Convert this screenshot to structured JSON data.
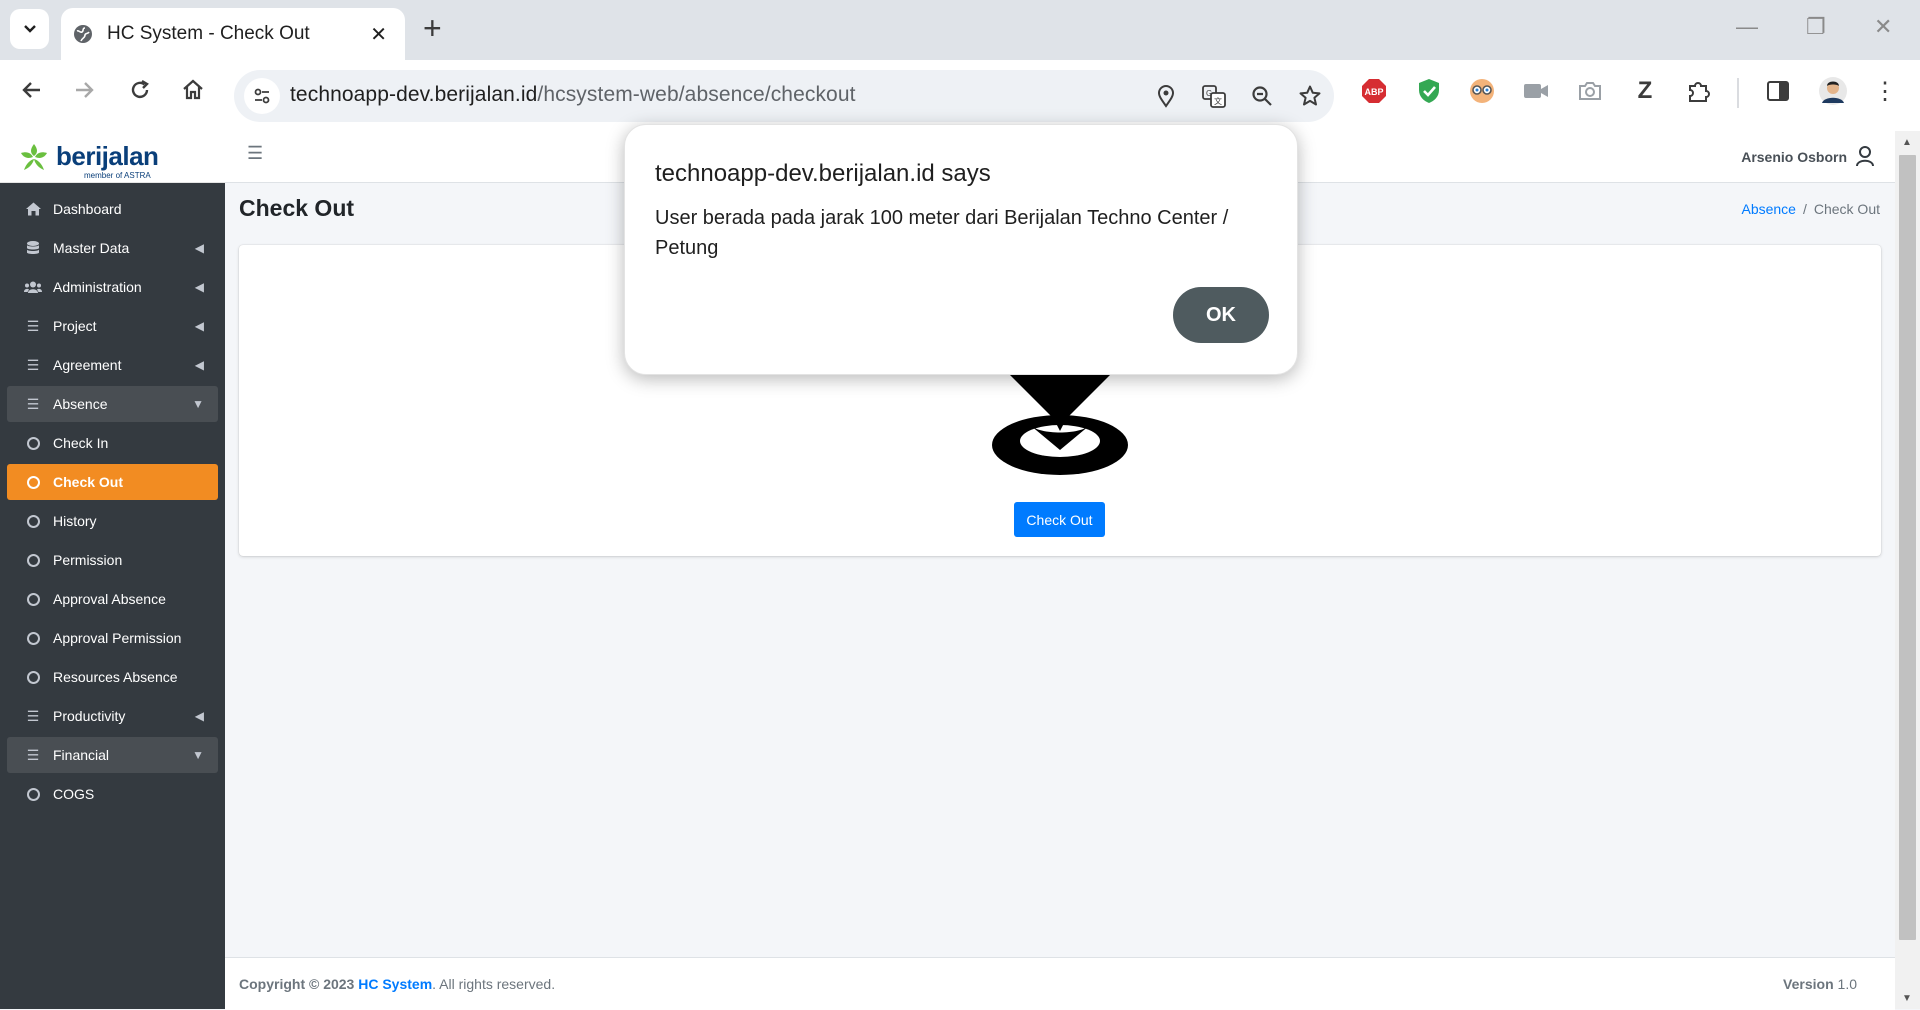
{
  "browser": {
    "tab_title": "HC System - Check Out",
    "url_host": "technoapp-dev.berijalan.id",
    "url_path": "/hcsystem-web/absence/checkout",
    "extensions": [
      "ABP",
      "shield",
      "glasses",
      "camera-off",
      "camera",
      "Z",
      "puzzle"
    ]
  },
  "app": {
    "brand_name": "berijalan",
    "brand_sub": "member of ASTRA",
    "user_name": "Arsenio Osborn",
    "page_title": "Check Out",
    "breadcrumb": {
      "parent": "Absence",
      "sep": "/",
      "current": "Check Out"
    },
    "checkout_button": "Check Out",
    "sidebar": [
      {
        "label": "Dashboard",
        "icon": "home-icon"
      },
      {
        "label": "Master Data",
        "icon": "database-icon"
      },
      {
        "label": "Administration",
        "icon": "users-icon"
      },
      {
        "label": "Project",
        "icon": "tasks-icon"
      },
      {
        "label": "Agreement",
        "icon": "tasks-icon"
      },
      {
        "label": "Absence",
        "icon": "tasks-icon"
      },
      {
        "label": "Check In",
        "icon": "circle-icon"
      },
      {
        "label": "Check Out",
        "icon": "circle-icon"
      },
      {
        "label": "History",
        "icon": "circle-icon"
      },
      {
        "label": "Permission",
        "icon": "circle-icon"
      },
      {
        "label": "Approval Absence",
        "icon": "circle-icon"
      },
      {
        "label": "Approval Permission",
        "icon": "circle-icon"
      },
      {
        "label": "Resources Absence",
        "icon": "circle-icon"
      },
      {
        "label": "Productivity",
        "icon": "tasks-icon"
      },
      {
        "label": "Financial",
        "icon": "tasks-icon"
      },
      {
        "label": "COGS",
        "icon": "circle-icon"
      }
    ],
    "footer": {
      "copyright": "Copyright © 2023",
      "brand": "HC System",
      "rights": ". All rights reserved.",
      "version_label": "Version",
      "version": "1.0"
    }
  },
  "dialog": {
    "title": "technoapp-dev.berijalan.id says",
    "message": "User berada pada jarak 100 meter dari Berijalan Techno Center / Petung",
    "ok": "OK"
  },
  "colors": {
    "sidebar_bg": "#343a40",
    "active_item": "#f28c22",
    "primary": "#007bff",
    "ok_button": "#4f5b5f"
  }
}
